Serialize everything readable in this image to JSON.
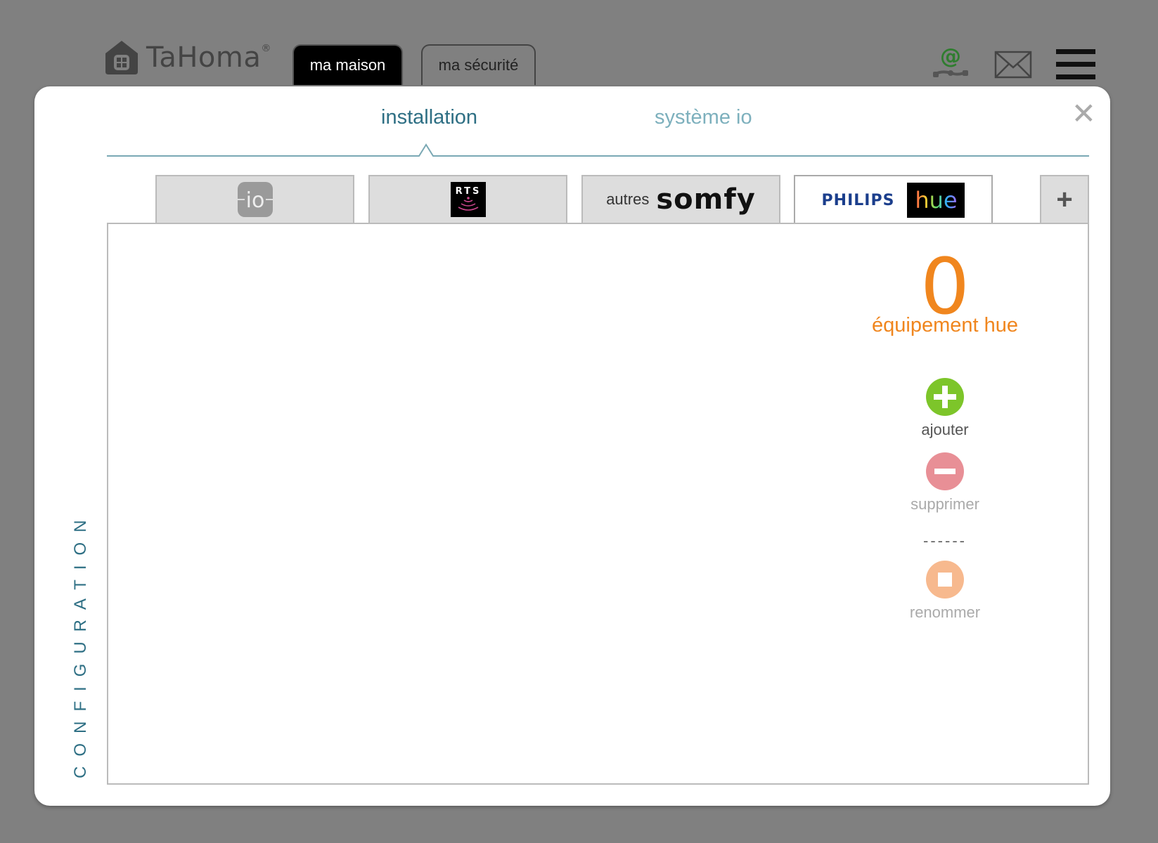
{
  "header": {
    "logo_text": "TaHoma",
    "logo_reg": "®",
    "home_btn": "ma maison",
    "security_btn": "ma sécurité"
  },
  "icons": {
    "logo": "house-icon",
    "connection": "at-connection-icon",
    "mail": "envelope-icon",
    "menu": "hamburger-menu-icon",
    "close": "close-icon",
    "add": "plus-circle-icon",
    "remove": "minus-circle-icon",
    "rename": "square-circle-icon"
  },
  "modal": {
    "close_symbol": "✕",
    "tabs": [
      {
        "label": "installation",
        "active": true
      },
      {
        "label": "système io",
        "active": false
      }
    ],
    "side_label": "CONFIGURATION",
    "protocols": {
      "io_label": "io",
      "rts_label": "RTS",
      "somfy_prefix": "autres",
      "somfy_word": "somfy",
      "philips_word": "PHILIPS",
      "hue_word": "hue",
      "add_symbol": "+"
    },
    "count": "0",
    "count_label": "équipement hue",
    "actions": {
      "add": "ajouter",
      "remove": "supprimer",
      "separator": "------",
      "rename": "renommer"
    }
  },
  "colors": {
    "backdrop": "#808080",
    "accent_teal": "#2e6f84",
    "accent_orange": "#f0861e",
    "add_green": "#7dc52a",
    "remove_pink": "#e88f96",
    "rename_peach": "#f7b98e"
  }
}
